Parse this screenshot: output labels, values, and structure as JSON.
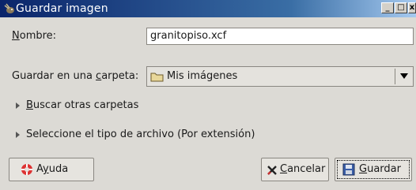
{
  "window": {
    "title": "Guardar imagen",
    "controls": {
      "minimize": "_",
      "maximize": "□",
      "close": "x"
    }
  },
  "form": {
    "name_label_mnemonic": "N",
    "name_label_rest": "ombre:",
    "name_value": "granitopiso.xcf",
    "folder_label_prefix": "Guardar en una ",
    "folder_label_mnemonic": "c",
    "folder_label_rest": "arpeta:",
    "folder_value": "Mis imágenes"
  },
  "expanders": {
    "browse_mnemonic": "B",
    "browse_rest": "uscar otras carpetas",
    "filetype": "Seleccione el tipo de archivo  (Por extensión)"
  },
  "buttons": {
    "help_prefix": "A",
    "help_mnemonic": "y",
    "help_rest": "uda",
    "cancel_mnemonic": "C",
    "cancel_rest": "ancelar",
    "save_mnemonic": "G",
    "save_rest": "uardar"
  },
  "colors": {
    "titlebar_start": "#0a246a",
    "titlebar_end": "#a6caf0",
    "dialog_bg": "#dcdad5"
  },
  "icons": {
    "title": "gimp-wilber-icon",
    "folder": "folder-icon",
    "help": "lifebuoy-help-icon",
    "cancel": "x-cancel-icon",
    "save": "floppy-save-icon"
  }
}
